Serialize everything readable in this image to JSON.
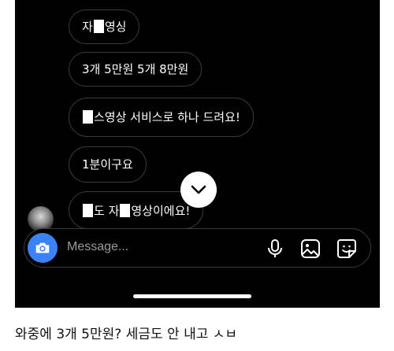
{
  "chat": {
    "messages": [
      {
        "before": "자",
        "after": "영싱"
      },
      {
        "text": "3개 5만원 5개 8만원"
      },
      {
        "after": "스영상 서비스로 하나 드려요!"
      },
      {
        "text": "1분이구요"
      },
      {
        "middle": "도 자",
        "after": "영상이에요!"
      }
    ]
  },
  "composer": {
    "placeholder": "Message...",
    "icons": [
      "camera-icon",
      "microphone-icon",
      "gallery-icon",
      "sticker-icon"
    ],
    "accent_color": "#3b82f6"
  },
  "scroll_button": {
    "icon": "chevron-down-icon"
  },
  "caption": {
    "text": "와중에 3개 5만원? 세금도 안 내고 ㅅㅂ"
  }
}
